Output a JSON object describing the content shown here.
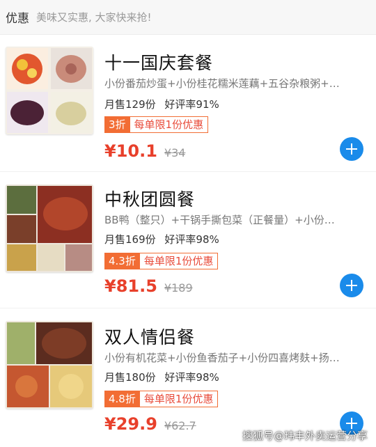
{
  "header": {
    "title": "优惠",
    "slogan": "美味又实惠, 大家快来抢!"
  },
  "items": [
    {
      "name": "十一国庆套餐",
      "desc": "小份番茄炒蛋+小份桂花糯米莲藕+五谷杂粮粥+…",
      "sales": "月售129份",
      "rating": "好评率91%",
      "discount": "3折",
      "limit": "每单限1份优惠",
      "price": "¥10.1",
      "orig_price": "¥34",
      "add_icon": "plus-icon"
    },
    {
      "name": "中秋团圆餐",
      "desc": "BB鸭（整只）+干锅手撕包菜（正餐量）+小份…",
      "sales": "月售169份",
      "rating": "好评率98%",
      "discount": "4.3折",
      "limit": "每单限1份优惠",
      "price": "¥81.5",
      "orig_price": "¥189",
      "add_icon": "plus-icon"
    },
    {
      "name": "双人情侣餐",
      "desc": "小份有机花菜+小份鱼香茄子+小份四喜烤麸+扬…",
      "sales": "月售180份",
      "rating": "好评率98%",
      "discount": "4.8折",
      "limit": "每单限1份优惠",
      "price": "¥29.9",
      "orig_price": "¥62.7",
      "add_icon": "plus-icon"
    }
  ],
  "watermark": "搜狐号@玮丰外卖运营分享",
  "colors": {
    "discount": "#f26d34",
    "price": "#e8402b",
    "add_button": "#1a8bea"
  }
}
